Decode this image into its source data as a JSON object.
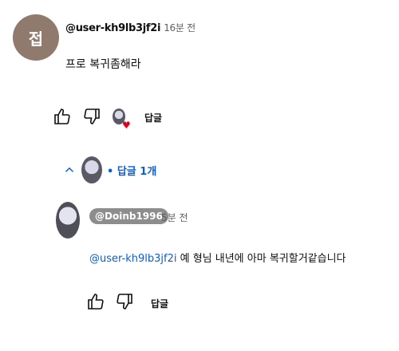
{
  "comment": {
    "avatar_initial": "접",
    "author": "@user-kh9lb3jf2i",
    "time": "16분 전",
    "text": "프로 복귀좀해라",
    "reply_label": "답글"
  },
  "replies_toggle": {
    "label": "• 답글 1개"
  },
  "reply": {
    "author": "@Doinb1996",
    "time": "5분 전",
    "mention": "@user-kh9lb3jf2i",
    "text": "예 형님 내년에 아마 복귀할거같습니다",
    "reply_label": "답글"
  },
  "colors": {
    "accent_blue": "#065fd4",
    "heart_red": "#e0001b"
  }
}
